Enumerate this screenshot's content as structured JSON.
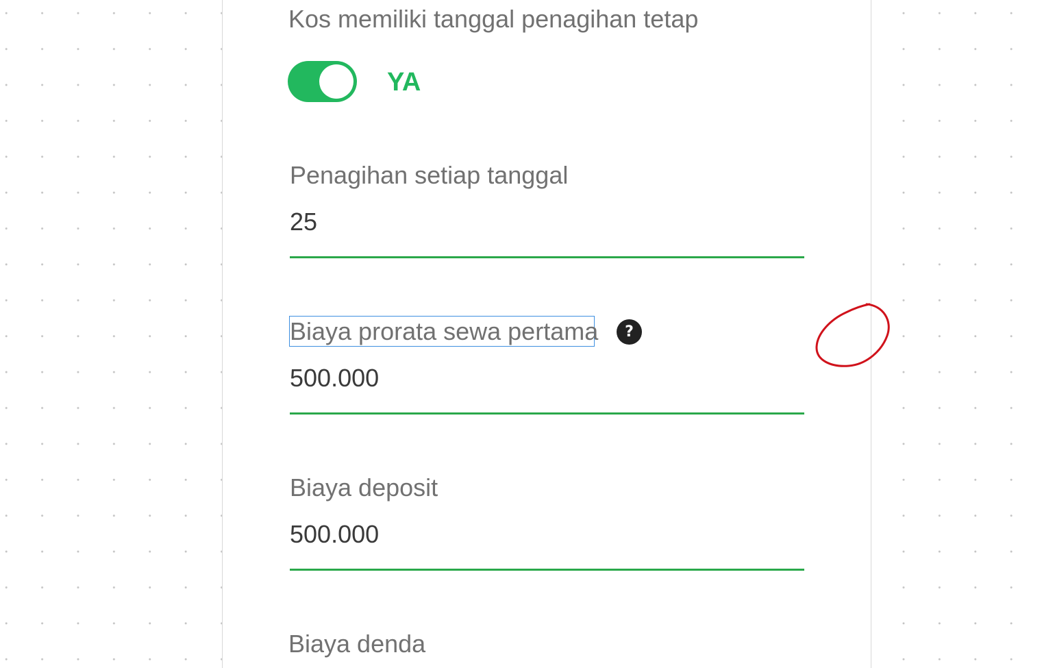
{
  "form": {
    "fixed_billing": {
      "label": "Kos memiliki tanggal penagihan tetap",
      "toggle_state": "on",
      "toggle_text": "YA"
    },
    "billing_date": {
      "label": "Penagihan setiap tanggal",
      "value": "25"
    },
    "prorata_fee": {
      "label": "Biaya prorata sewa pertama",
      "value": "500.000",
      "help_icon_glyph": "?"
    },
    "deposit_fee": {
      "label": "Biaya deposit",
      "value": "500.000"
    },
    "late_fee": {
      "label": "Biaya denda"
    }
  },
  "colors": {
    "accent_green": "#22b85e",
    "underline_green": "#2aa84a",
    "focus_blue": "#3d8fe0",
    "annotation_red": "#d0121b"
  },
  "icons": {
    "help": "question-circle-icon",
    "annotation": "red-hand-drawn-circle"
  }
}
